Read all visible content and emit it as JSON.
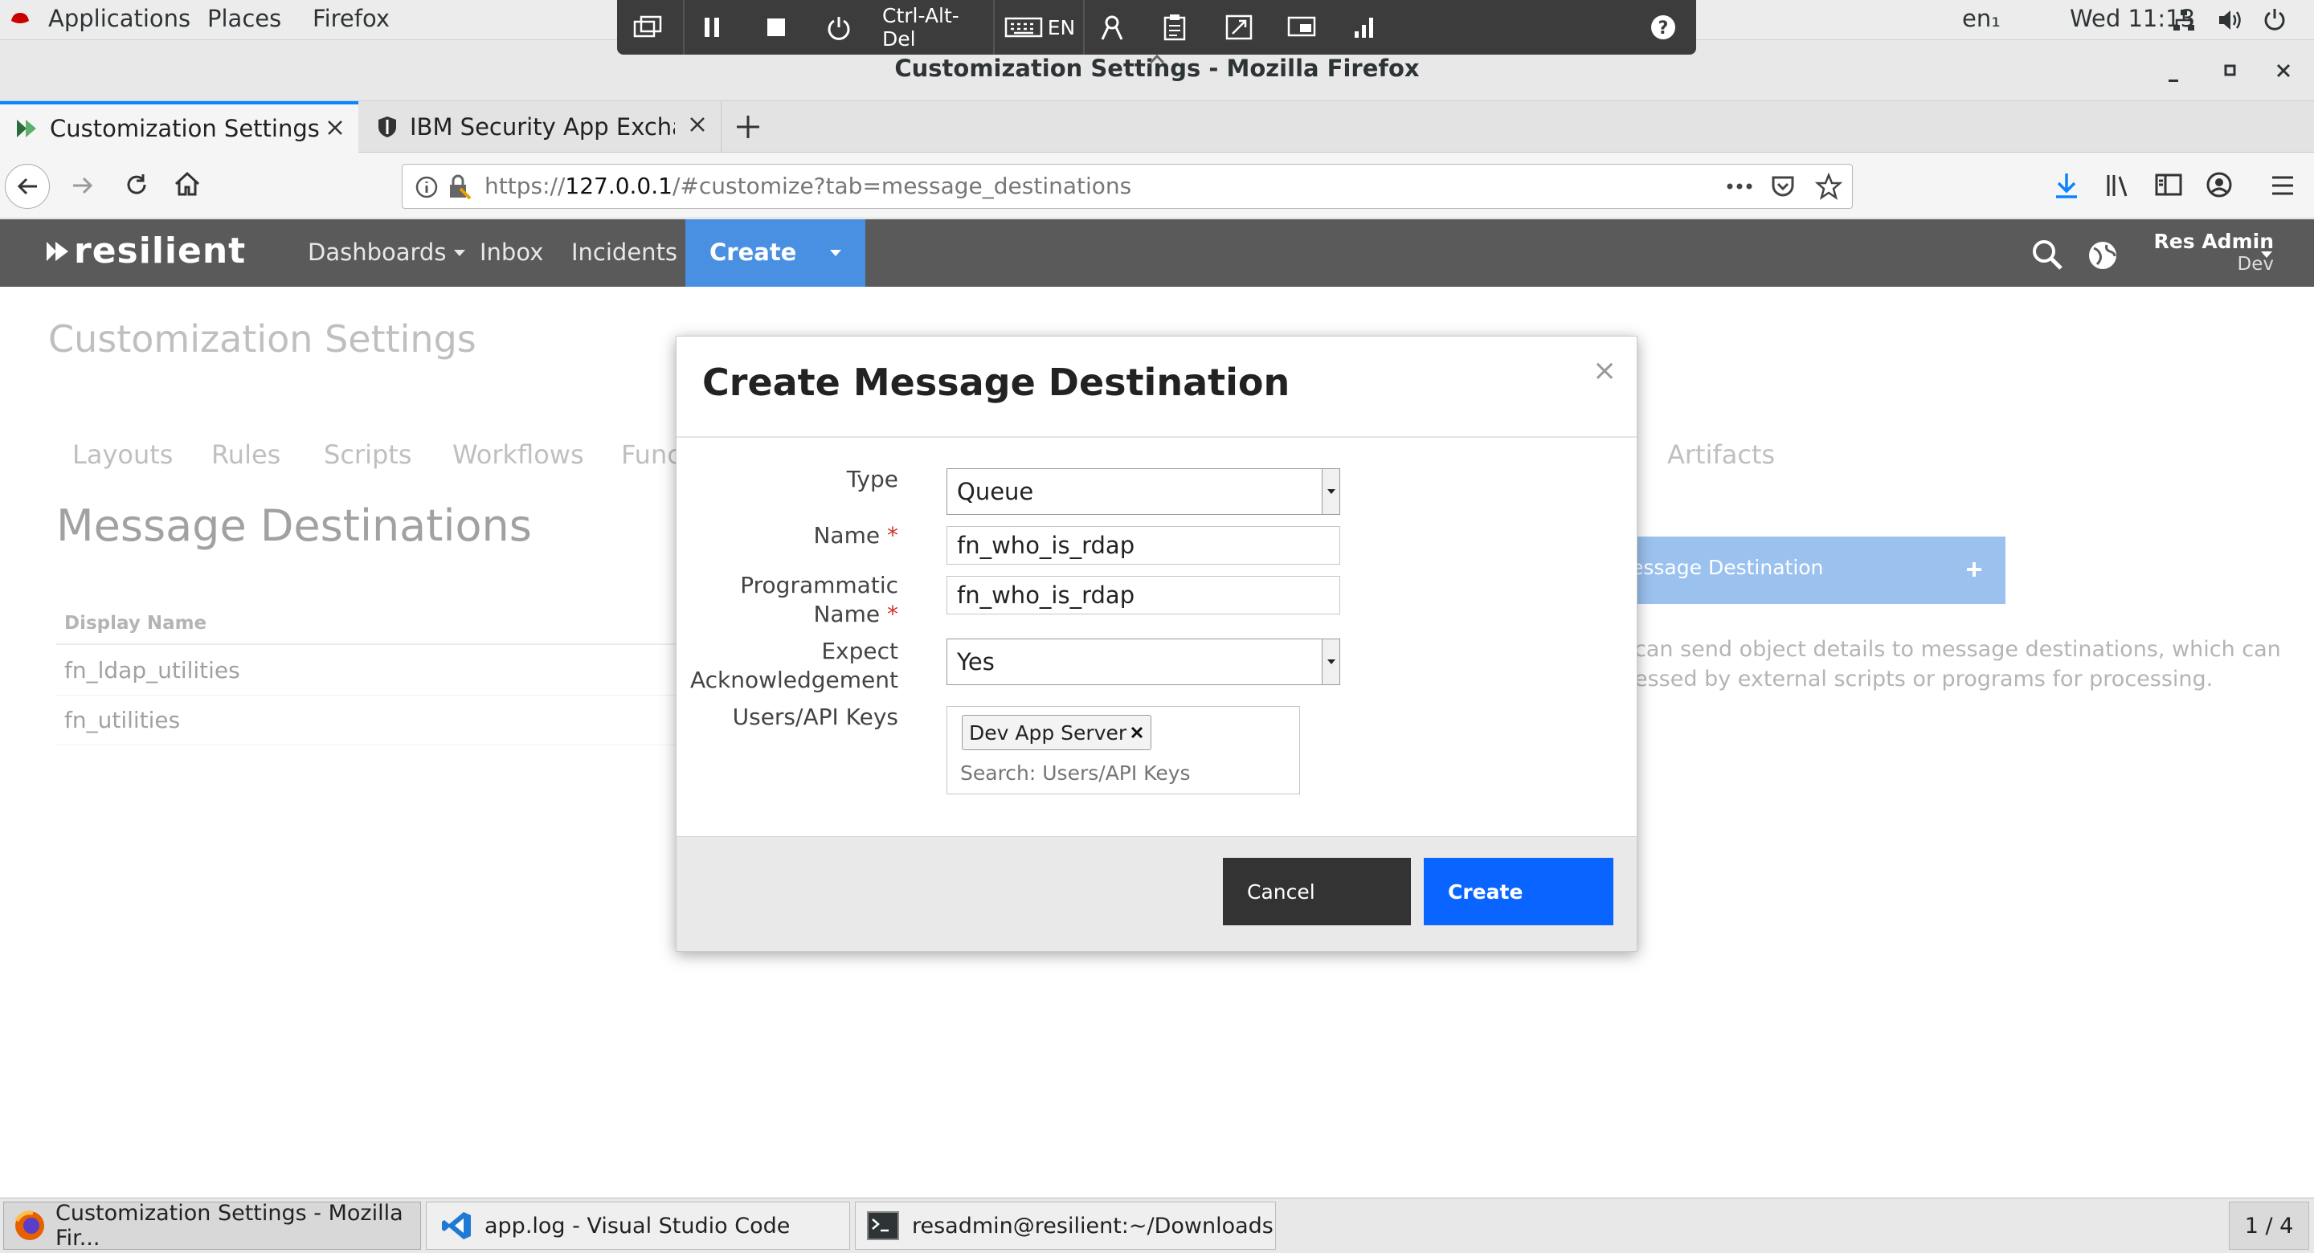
{
  "gnome": {
    "menus": [
      "Applications",
      "Places",
      "Firefox"
    ],
    "input_method": "en₁",
    "clock": "Wed 11:13"
  },
  "vm_toolbar": {
    "ctrl_alt_del": "Ctrl-Alt-Del",
    "keyboard_lang": "EN"
  },
  "window": {
    "title": "Customization Settings - Mozilla Firefox"
  },
  "browser": {
    "tabs": [
      {
        "label": "Customization Settings"
      },
      {
        "label": "IBM Security App Exchange"
      }
    ],
    "url_prefix": "https://",
    "url_host": "127.0.0.1",
    "url_path": "/#customize?tab=message_destinations"
  },
  "app": {
    "logo": "resilient",
    "nav": {
      "dashboards": "Dashboards",
      "inbox": "Inbox",
      "incidents": "Incidents",
      "create": "Create"
    },
    "user": {
      "name": "Res Admin",
      "org": "Dev"
    }
  },
  "page": {
    "title": "Customization Settings",
    "subtabs": [
      "Layouts",
      "Rules",
      "Scripts",
      "Workflows",
      "Func",
      "Artifacts"
    ],
    "section_title": "Message Destinations",
    "table": {
      "header": "Display Name",
      "rows": [
        "fn_ldap_utilities",
        "fn_utilities"
      ]
    },
    "add_button": "essage Destination",
    "help_line1": "can send object details to message destinations, which can",
    "help_line2": "essed by external scripts or programs for processing."
  },
  "modal": {
    "title": "Create Message Destination",
    "close": "×",
    "fields": {
      "type_label": "Type",
      "type_value": "Queue",
      "name_label": "Name",
      "name_value": "fn_who_is_rdap",
      "prog_label_1": "Programmatic",
      "prog_label_2": "Name",
      "prog_value": "fn_who_is_rdap",
      "ack_label_1": "Expect",
      "ack_label_2": "Acknowledgement",
      "ack_value": "Yes",
      "users_label": "Users/API Keys",
      "users_tag": "Dev App Server",
      "users_placeholder": "Search: Users/API Keys"
    },
    "required_mark": "*",
    "cancel": "Cancel",
    "create": "Create"
  },
  "taskbar": {
    "items": [
      "Customization Settings - Mozilla Fir...",
      "app.log - Visual Studio Code",
      "resadmin@resilient:~/Downloads"
    ],
    "workspace": "1 / 4"
  },
  "colors": {
    "accent_blue": "#0a64ff",
    "header_gray": "#5a5a5a",
    "create_nav_blue": "#4a90e2",
    "cancel_dark": "#333333"
  }
}
